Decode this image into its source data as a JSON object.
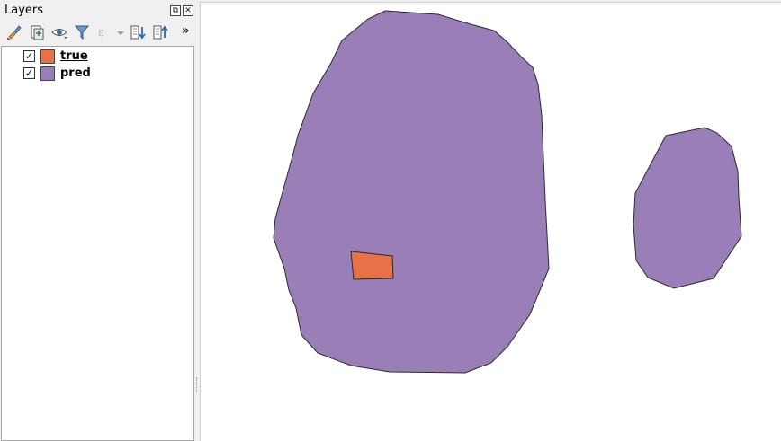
{
  "panel": {
    "title": "Layers",
    "float_glyph": "⧉",
    "close_glyph": "✕",
    "more_label": "»"
  },
  "toolbar": {
    "tools": [
      {
        "icon": "style-brush-icon"
      },
      {
        "icon": "add-group-icon"
      },
      {
        "icon": "visibility-eye-icon"
      },
      {
        "icon": "filter-icon"
      },
      {
        "icon": "expression-filter-icon"
      },
      {
        "icon": "expand-all-icon"
      },
      {
        "icon": "collapse-all-icon"
      }
    ]
  },
  "layers": [
    {
      "name": "true",
      "checked": true,
      "check_glyph": "✓",
      "color": "#e8714a",
      "active": true
    },
    {
      "name": "pred",
      "checked": true,
      "check_glyph": "✓",
      "color": "#9a7eb8",
      "active": false
    }
  ],
  "map": {
    "background": "#ffffff",
    "stroke_color": "#2b2b2b",
    "features": [
      {
        "layer": "pred",
        "color": "#9a7eb8"
      },
      {
        "layer": "pred",
        "color": "#9a7eb8"
      },
      {
        "layer": "true",
        "color": "#e8714a"
      }
    ]
  }
}
